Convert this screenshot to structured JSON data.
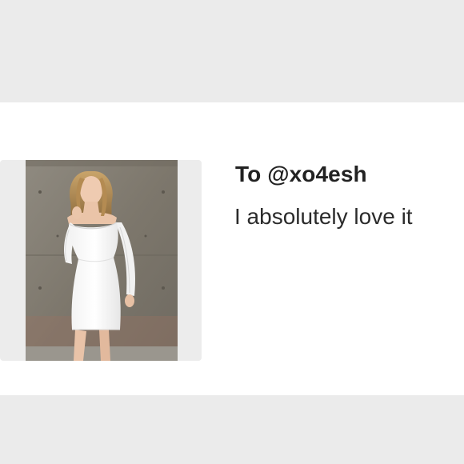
{
  "gift_card": {
    "recipient": "To @xo4esh",
    "message": "I absolutely love it"
  },
  "product_image": {
    "icon": "product-photo",
    "subject": "white off-shoulder lace mini dress"
  },
  "colors": {
    "page_background": "#ebebeb",
    "card_background": "#ffffff",
    "text": "#222222"
  }
}
